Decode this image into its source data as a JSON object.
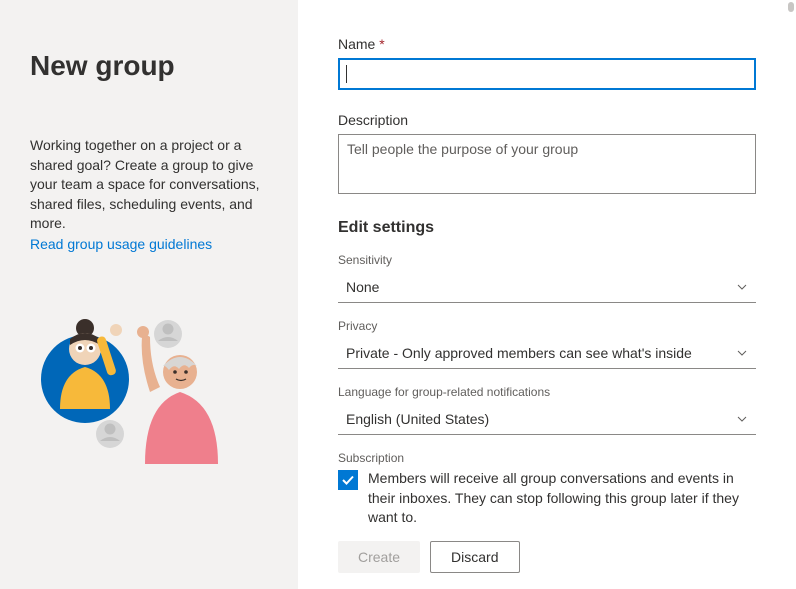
{
  "left": {
    "title": "New group",
    "description": "Working together on a project or a shared goal? Create a group to give your team a space for conversations, shared files, scheduling events, and more.",
    "link_text": "Read group usage guidelines"
  },
  "form": {
    "name_label": "Name",
    "name_value": "",
    "description_label": "Description",
    "description_placeholder": "Tell people the purpose of your group",
    "description_value": "",
    "settings_title": "Edit settings",
    "sensitivity_label": "Sensitivity",
    "sensitivity_value": "None",
    "privacy_label": "Privacy",
    "privacy_value": "Private - Only approved members can see what's inside",
    "language_label": "Language for group-related notifications",
    "language_value": "English (United States)",
    "subscription_label": "Subscription",
    "subscription_text": "Members will receive all group conversations and events in their inboxes. They can stop following this group later if they want to.",
    "subscription_checked": true
  },
  "footer": {
    "create_label": "Create",
    "discard_label": "Discard"
  }
}
